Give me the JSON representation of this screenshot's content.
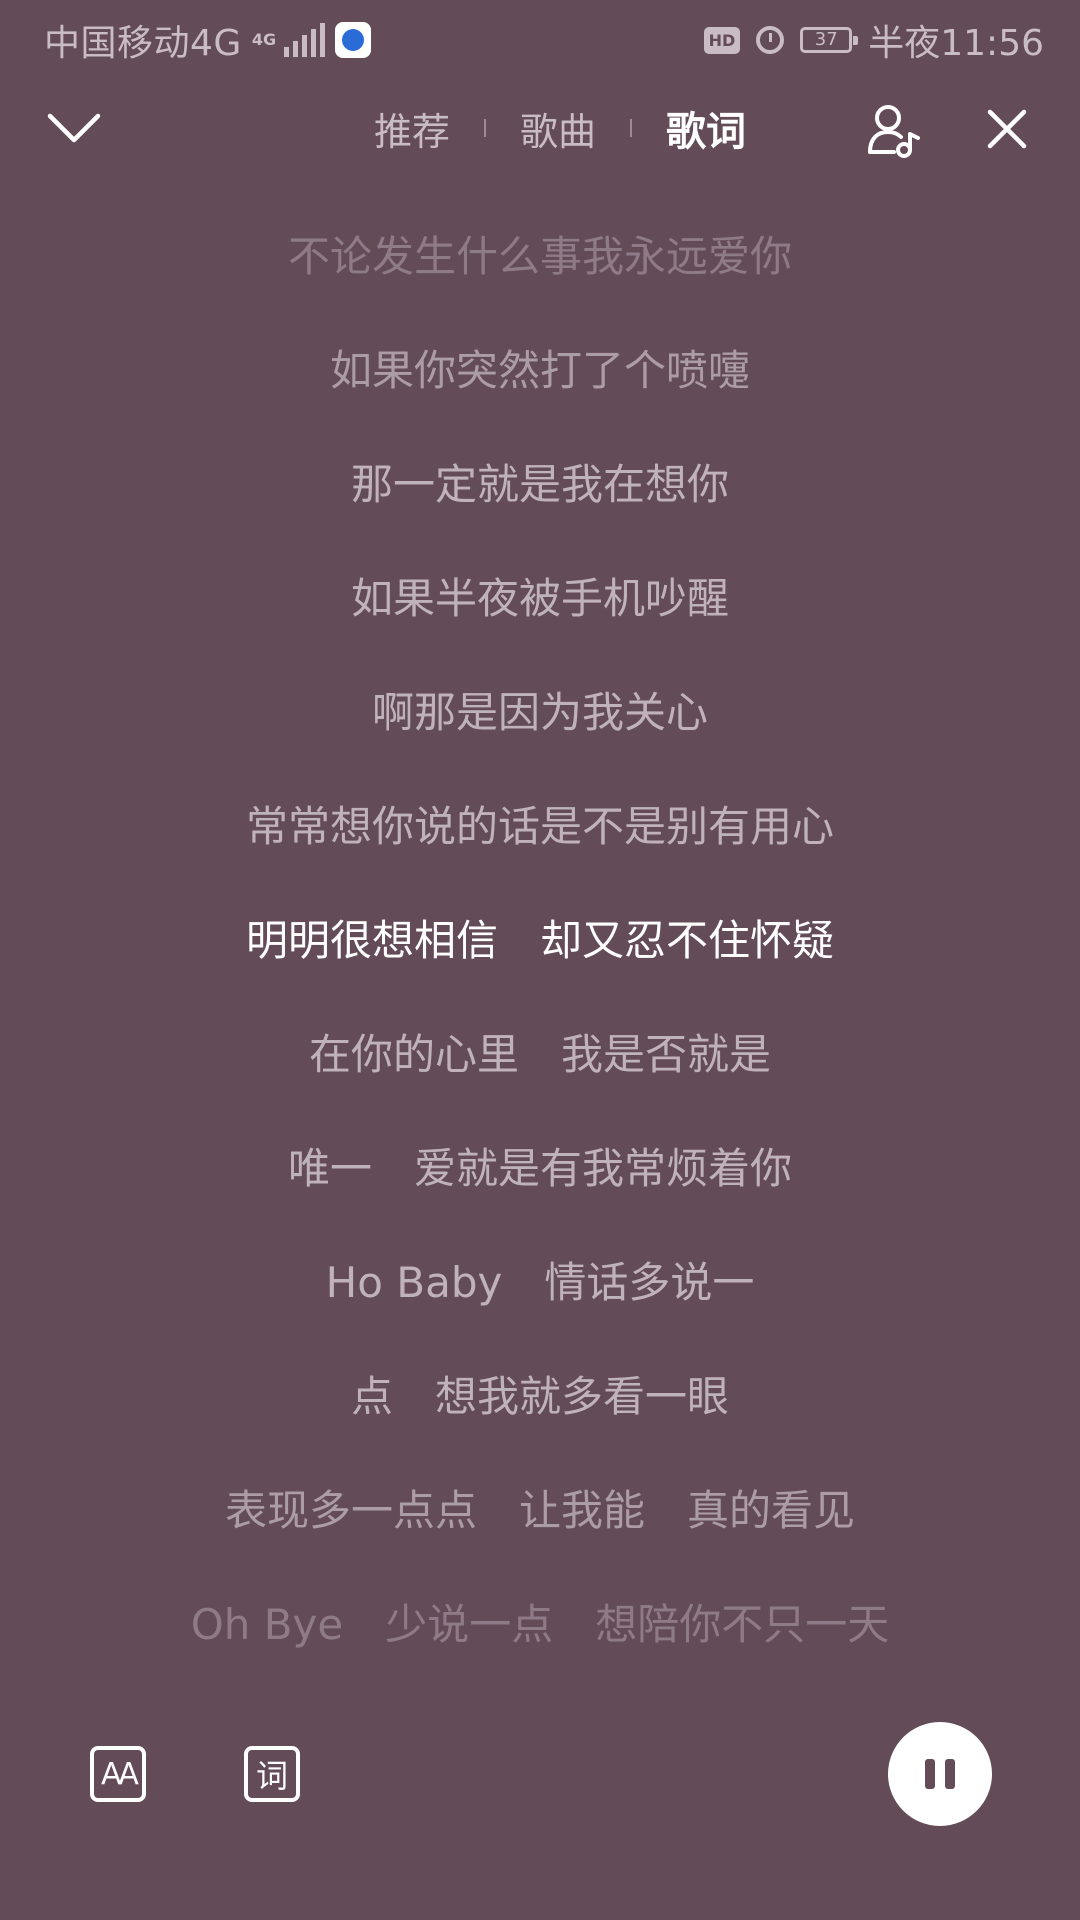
{
  "status_bar": {
    "carrier": "中国移动4G",
    "network_tag": "4G",
    "hd": "HD",
    "battery": "37",
    "time": "半夜11:56"
  },
  "nav": {
    "tabs": [
      {
        "label": "推荐"
      },
      {
        "label": "歌曲"
      },
      {
        "label": "歌词"
      }
    ],
    "active_tab": "歌词"
  },
  "lyrics": [
    "不论发生什么事我永远爱你",
    "如果你突然打了个喷嚏",
    "那一定就是我在想你",
    "如果半夜被手机吵醒",
    "啊那是因为我关心",
    "常常想你说的话是不是别有用心",
    "明明很想相信　却又忍不住怀疑",
    "在你的心里　我是否就是",
    "唯一　爱就是有我常烦着你",
    "Ho Baby　情话多说一",
    "点　想我就多看一眼",
    "表现多一点点　让我能　真的看见",
    "Oh Bye　少说一点　想陪你不只一天"
  ],
  "controls": {
    "font_button": "AA",
    "lyric_button": "词"
  },
  "icons": {
    "collapse": "chevron-down-icon",
    "singer": "singer-music-icon",
    "close": "close-icon",
    "play": "pause-icon"
  },
  "colors": {
    "background": "#634b58",
    "active_text": "#ffffff",
    "inactive_text": "#c0b2bb"
  }
}
